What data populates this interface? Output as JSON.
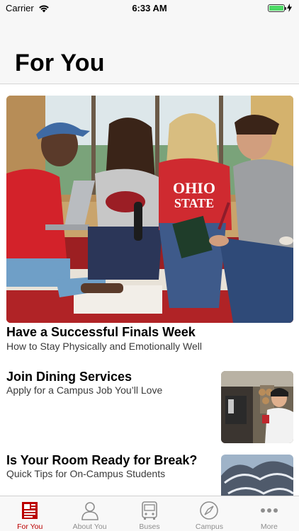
{
  "status": {
    "carrier": "Carrier",
    "time": "6:33 AM",
    "battery_level": 1.0
  },
  "header": {
    "title": "For You"
  },
  "hero": {
    "title": "Have a Successful Finals Week",
    "subtitle": "How to Stay Physically and Emotionally Well",
    "shirt_text": "THE OHIO STATE UNIVERSITY"
  },
  "articles": [
    {
      "title": "Join Dining Services",
      "subtitle": "Apply for a Campus Job You’ll Love"
    },
    {
      "title": "Is Your Room Ready for Break?",
      "subtitle": "Quick Tips for On-Campus Students"
    }
  ],
  "tabs": [
    {
      "label": "For You",
      "icon": "newspaper-icon",
      "active": true
    },
    {
      "label": "About You",
      "icon": "person-icon",
      "active": false
    },
    {
      "label": "Buses",
      "icon": "bus-icon",
      "active": false
    },
    {
      "label": "Campus",
      "icon": "compass-icon",
      "active": false
    },
    {
      "label": "More",
      "icon": "more-dots-icon",
      "active": false
    }
  ],
  "colors": {
    "accent": "#bb0000",
    "inactive": "#8e8e8e",
    "battery": "#4cd964"
  }
}
